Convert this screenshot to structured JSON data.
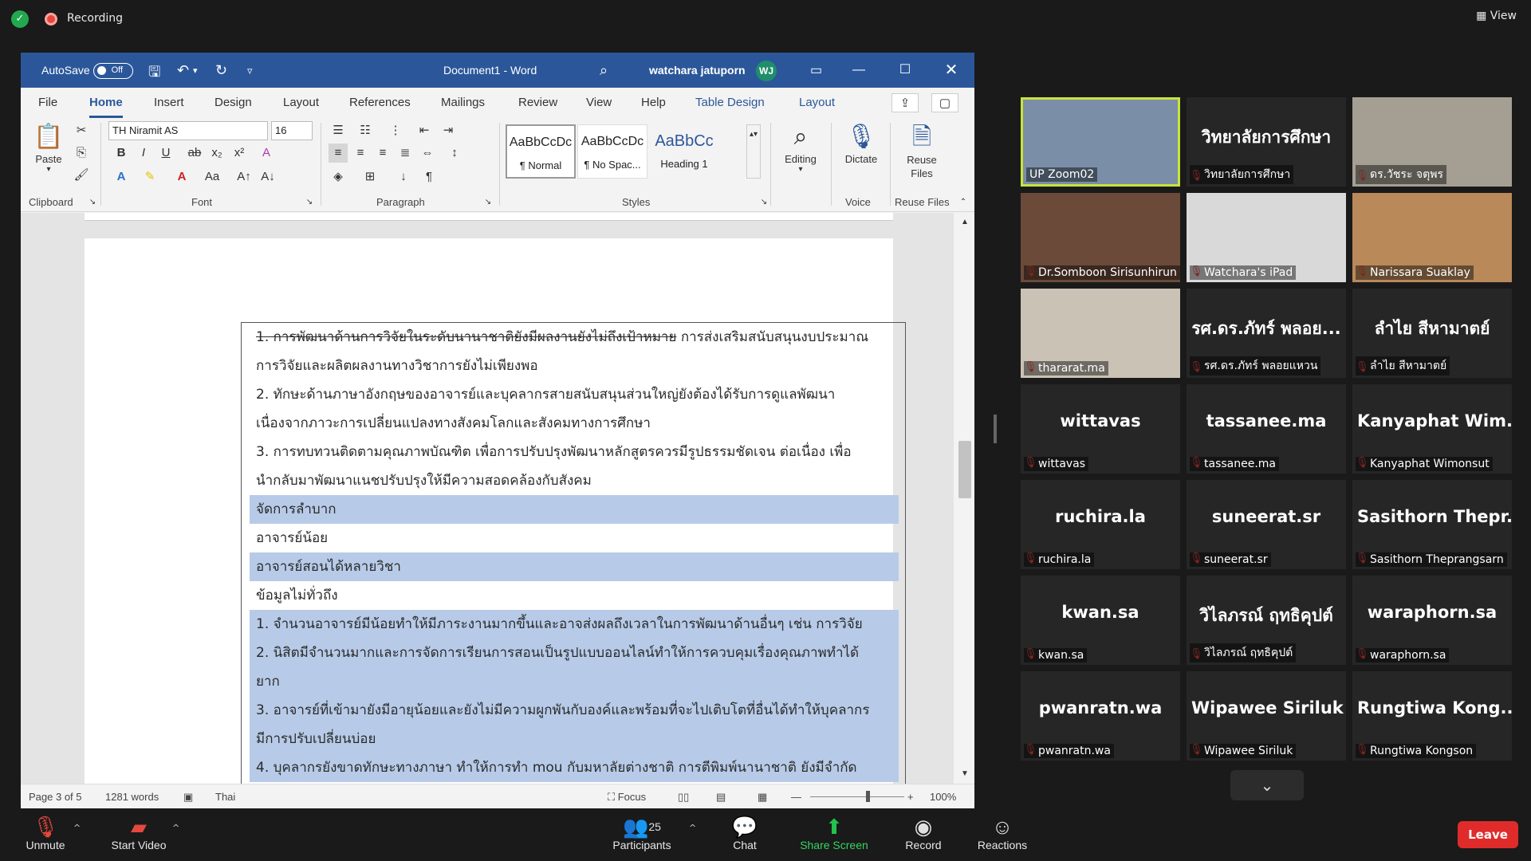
{
  "zoom": {
    "recording_label": "Recording",
    "view_label": "View",
    "toolbar": {
      "unmute": "Unmute",
      "start_video": "Start Video",
      "participants_label": "Participants",
      "participants_count": "25",
      "chat": "Chat",
      "share_screen": "Share Screen",
      "record": "Record",
      "reactions": "Reactions",
      "leave": "Leave"
    }
  },
  "word": {
    "autosave_label": "AutoSave",
    "autosave_state": "Off",
    "doc_title": "Document1  -  Word",
    "user_name": "watchara jatuporn",
    "user_initials": "WJ",
    "tabs": [
      "File",
      "Home",
      "Insert",
      "Design",
      "Layout",
      "References",
      "Mailings",
      "Review",
      "View",
      "Help",
      "Table Design",
      "Layout"
    ],
    "ribbon": {
      "paste": "Paste",
      "font_name": "TH Niramit AS",
      "font_size": "16",
      "styles": [
        {
          "preview": "AaBbCcDc",
          "name": "¶ Normal"
        },
        {
          "preview": "AaBbCcDc",
          "name": "¶ No Spac..."
        },
        {
          "preview": "AaBbCc",
          "name": "Heading 1"
        }
      ],
      "editing": "Editing",
      "dictate": "Dictate",
      "reuse_files": "Reuse Files",
      "groups": {
        "clipboard": "Clipboard",
        "font": "Font",
        "paragraph": "Paragraph",
        "styles": "Styles",
        "voice": "Voice",
        "reuse": "Reuse Files"
      }
    },
    "document": {
      "rows": [
        {
          "lines": [
            "1. การพัฒนาด้านการวิจัยในระดับนานาชาติยังมีผลงานยังไม่ถึงเป้าหมาย การส่งเสริมสนับสนุนงบประมาณ",
            "การวิจัยและผลิตผลงานทางวิชาการยังไม่เพียงพอ"
          ]
        },
        {
          "lines": [
            "2. ทักษะด้านภาษาอังกฤษของอาจารย์และบุคลากรสายสนับสนุนส่วนใหญ่ยังต้องได้รับการดูแลพัฒนา",
            "เนื่องจากภาวะการเปลี่ยนแปลงทางสังคมโลกและสังคมทางการศึกษา"
          ]
        },
        {
          "lines": [
            "3. การทบทวนติดตามคุณภาพบัณฑิต เพื่อการปรับปรุงพัฒนาหลักสูตรควรมีรูปธรรมชัดเจน ต่อเนื่อง เพื่อ",
            "นำกลับมาพัฒนาแนชปรับปรุงให้มีความสอดคล้องกับสังคม"
          ]
        },
        {
          "lines": [
            "จัดการลำบาก"
          ]
        },
        {
          "lines": [
            "อาจารย์น้อย"
          ]
        },
        {
          "lines": [
            "อาจารย์สอนได้หลายวิชา"
          ]
        },
        {
          "lines": [
            "ข้อมูลไม่ทั่วถึง"
          ]
        },
        {
          "lines": [
            "1. จำนวนอาจารย์มีน้อยทำให้มีภาระงานมากขึ้นและอาจส่งผลถึงเวลาในการพัฒนาด้านอื่นๆ เช่น การวิจัย",
            "2. นิสิตมีจำนวนมากและการจัดการเรียนการสอนเป็นรูปแบบออนไลน์ทำให้การควบคุมเรื่องคุณภาพทำได้",
            "ยาก",
            "3. อาจารย์ที่เข้ามายังมีอายุน้อยและยังไม่มีความผูกพันกับองค์และพร้อมที่จะไปเติบโตที่อื่นได้ทำให้บุคลากร",
            "มีการปรับเปลี่ยนบ่อย",
            "4. บุคลากรยังขาดทักษะทางภาษา ทำให้การทำ mou กับมหาลัยต่างชาติ การตีพิมพ์นานาชาติ ยังมีจำกัด"
          ]
        }
      ]
    },
    "status": {
      "page": "Page 3 of 5",
      "words": "1281 words",
      "language": "Thai",
      "focus": "Focus",
      "zoom": "100%"
    }
  },
  "participants": [
    {
      "big": "",
      "name": "UP Zoom02",
      "video": true,
      "active": true
    },
    {
      "big": "วิทยาลัยการศึกษา",
      "name": "วิทยาลัยการศึกษา",
      "video": false
    },
    {
      "big": "",
      "name": "ดร.วัชระ จตุพร",
      "video": true
    },
    {
      "big": "",
      "name": "Dr.Somboon Sirisunhirun",
      "video": true
    },
    {
      "big": "",
      "name": "Watchara's iPad",
      "video": true
    },
    {
      "big": "",
      "name": "Narissara Suaklay",
      "video": true
    },
    {
      "big": "",
      "name": "thararat.ma",
      "video": true
    },
    {
      "big": "รศ.ดร.ภัทร์ พลอย...",
      "name": "รศ.ดร.ภัทร์ พลอยแหวน",
      "video": false
    },
    {
      "big": "ลำไย สีหามาตย์",
      "name": "ลำไย สีหามาตย์",
      "video": false
    },
    {
      "big": "wittavas",
      "name": "wittavas",
      "video": false
    },
    {
      "big": "tassanee.ma",
      "name": "tassanee.ma",
      "video": false
    },
    {
      "big": "Kanyaphat  Wim...",
      "name": "Kanyaphat Wimonsut",
      "video": false
    },
    {
      "big": "ruchira.la",
      "name": "ruchira.la",
      "video": false
    },
    {
      "big": "suneerat.sr",
      "name": "suneerat.sr",
      "video": false
    },
    {
      "big": "Sasithorn  Thepr...",
      "name": "Sasithorn Theprangsarn",
      "video": false
    },
    {
      "big": "kwan.sa",
      "name": "kwan.sa",
      "video": false
    },
    {
      "big": "วิไลภรณ์ ฤทธิคุปต์",
      "name": "วิไลภรณ์ ฤทธิคุปต์",
      "video": false
    },
    {
      "big": "waraphorn.sa",
      "name": "waraphorn.sa",
      "video": false
    },
    {
      "big": "pwanratn.wa",
      "name": "pwanratn.wa",
      "video": false
    },
    {
      "big": "Wipawee Siriluk",
      "name": "Wipawee Siriluk",
      "video": false
    },
    {
      "big": "Rungtiwa  Kong...",
      "name": "Rungtiwa Kongson",
      "video": false
    }
  ]
}
